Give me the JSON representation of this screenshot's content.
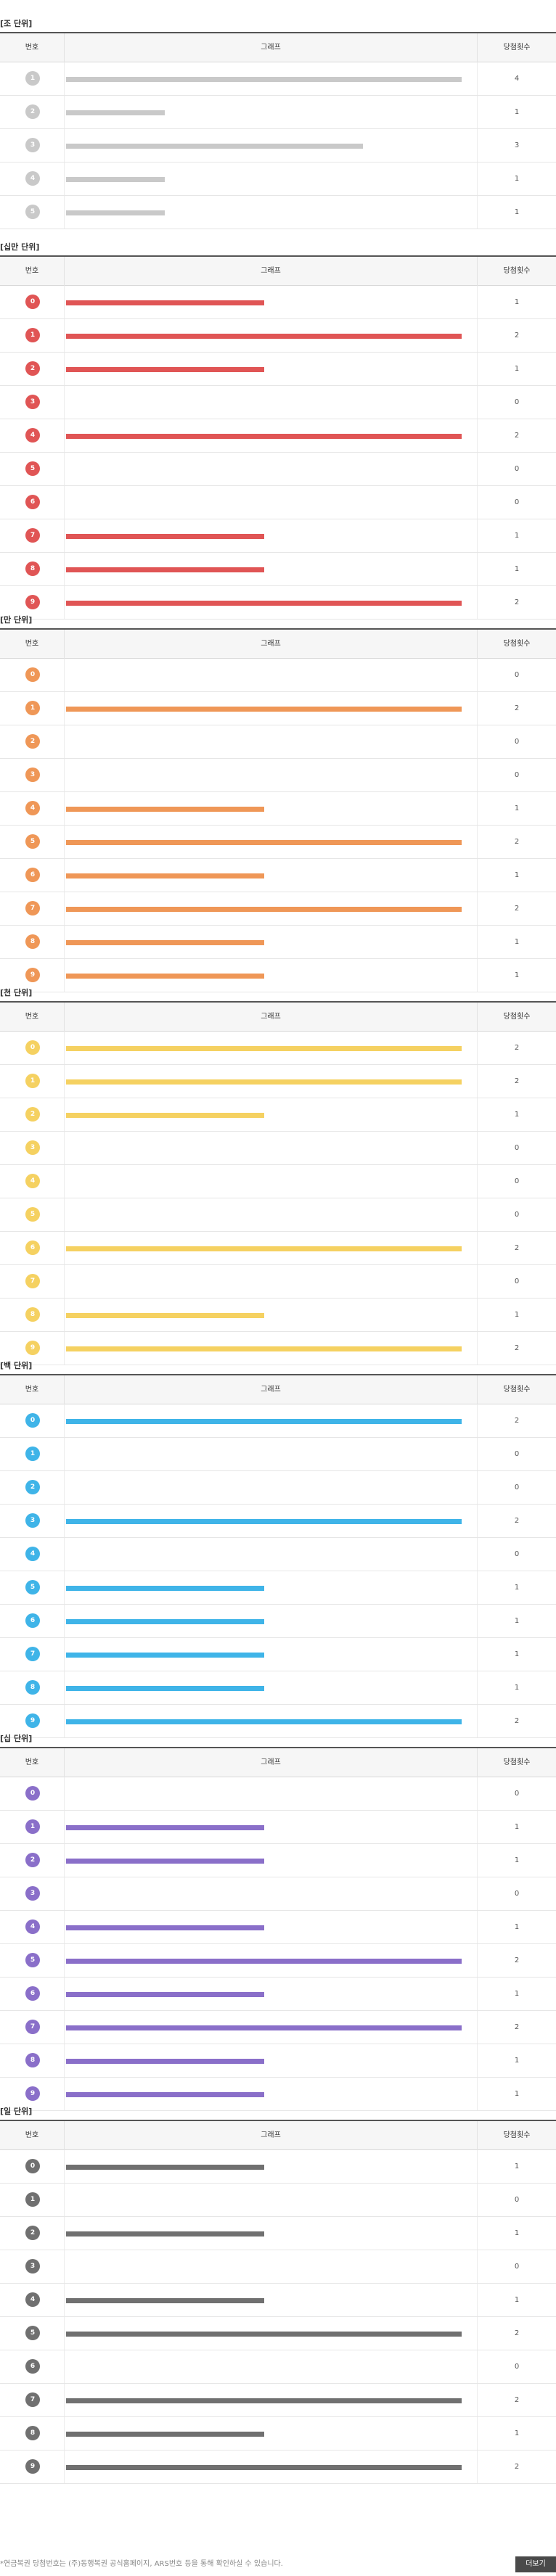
{
  "chart_data": {
    "type": "bar",
    "header": {
      "number": "번호",
      "graph": "그래프",
      "count": "당첨횟수"
    },
    "sections": [
      {
        "title": "[조 단위]",
        "color": "#c9c9c9",
        "categories": [
          "1",
          "2",
          "3",
          "4",
          "5"
        ],
        "values": [
          4,
          1,
          3,
          1,
          1
        ],
        "max": 4
      },
      {
        "title": "[십만 단위]",
        "color": "#e05555",
        "categories": [
          "0",
          "1",
          "2",
          "3",
          "4",
          "5",
          "6",
          "7",
          "8",
          "9"
        ],
        "values": [
          1,
          2,
          1,
          0,
          2,
          0,
          0,
          1,
          1,
          2
        ],
        "max": 2
      },
      {
        "title": "[만 단위]",
        "color": "#ef9757",
        "categories": [
          "0",
          "1",
          "2",
          "3",
          "4",
          "5",
          "6",
          "7",
          "8",
          "9"
        ],
        "values": [
          0,
          2,
          0,
          0,
          1,
          2,
          1,
          2,
          1,
          1
        ],
        "max": 2
      },
      {
        "title": "[천 단위]",
        "color": "#f5d161",
        "categories": [
          "0",
          "1",
          "2",
          "3",
          "4",
          "5",
          "6",
          "7",
          "8",
          "9"
        ],
        "values": [
          2,
          2,
          1,
          0,
          0,
          0,
          2,
          0,
          1,
          2
        ],
        "max": 2
      },
      {
        "title": "[백 단위]",
        "color": "#3fb4e8",
        "categories": [
          "0",
          "1",
          "2",
          "3",
          "4",
          "5",
          "6",
          "7",
          "8",
          "9"
        ],
        "values": [
          2,
          0,
          0,
          2,
          0,
          1,
          1,
          1,
          1,
          2
        ],
        "max": 2
      },
      {
        "title": "[십 단위]",
        "color": "#8a6fc9",
        "categories": [
          "0",
          "1",
          "2",
          "3",
          "4",
          "5",
          "6",
          "7",
          "8",
          "9"
        ],
        "values": [
          0,
          1,
          1,
          0,
          1,
          2,
          1,
          2,
          1,
          1
        ],
        "max": 2
      },
      {
        "title": "[일 단위]",
        "color": "#707070",
        "categories": [
          "0",
          "1",
          "2",
          "3",
          "4",
          "5",
          "6",
          "7",
          "8",
          "9"
        ],
        "values": [
          1,
          0,
          1,
          0,
          1,
          2,
          0,
          2,
          1,
          2
        ],
        "max": 2
      }
    ]
  },
  "footer": {
    "note": "*연금복권 당첨번호는 (주)동행복권 공식홈페이지, ARS번호 등을 통해 확인하실 수 있습니다.",
    "more_label": "더보기"
  }
}
